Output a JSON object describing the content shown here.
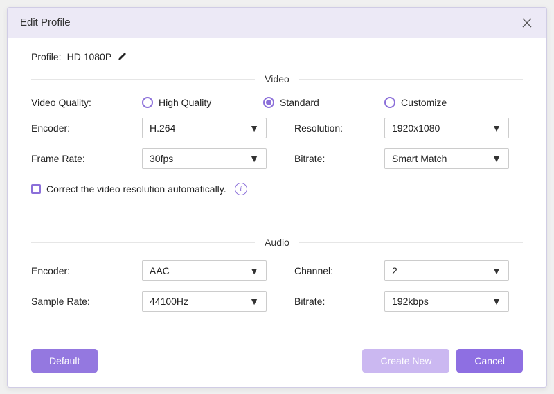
{
  "titlebar": {
    "title": "Edit Profile"
  },
  "profile": {
    "label": "Profile:",
    "name": "HD 1080P"
  },
  "sections": {
    "video": "Video",
    "audio": "Audio"
  },
  "video": {
    "quality_label": "Video Quality:",
    "quality_options": {
      "high": "High Quality",
      "standard": "Standard",
      "customize": "Customize"
    },
    "quality_selected": "standard",
    "encoder_label": "Encoder:",
    "encoder_value": "H.264",
    "framerate_label": "Frame Rate:",
    "framerate_value": "30fps",
    "resolution_label": "Resolution:",
    "resolution_value": "1920x1080",
    "bitrate_label": "Bitrate:",
    "bitrate_value": "Smart Match",
    "auto_resolution_label": "Correct the video resolution automatically."
  },
  "audio": {
    "encoder_label": "Encoder:",
    "encoder_value": "AAC",
    "samplerate_label": "Sample Rate:",
    "samplerate_value": "44100Hz",
    "channel_label": "Channel:",
    "channel_value": "2",
    "bitrate_label": "Bitrate:",
    "bitrate_value": "192kbps"
  },
  "buttons": {
    "default": "Default",
    "create_new": "Create New",
    "cancel": "Cancel"
  }
}
